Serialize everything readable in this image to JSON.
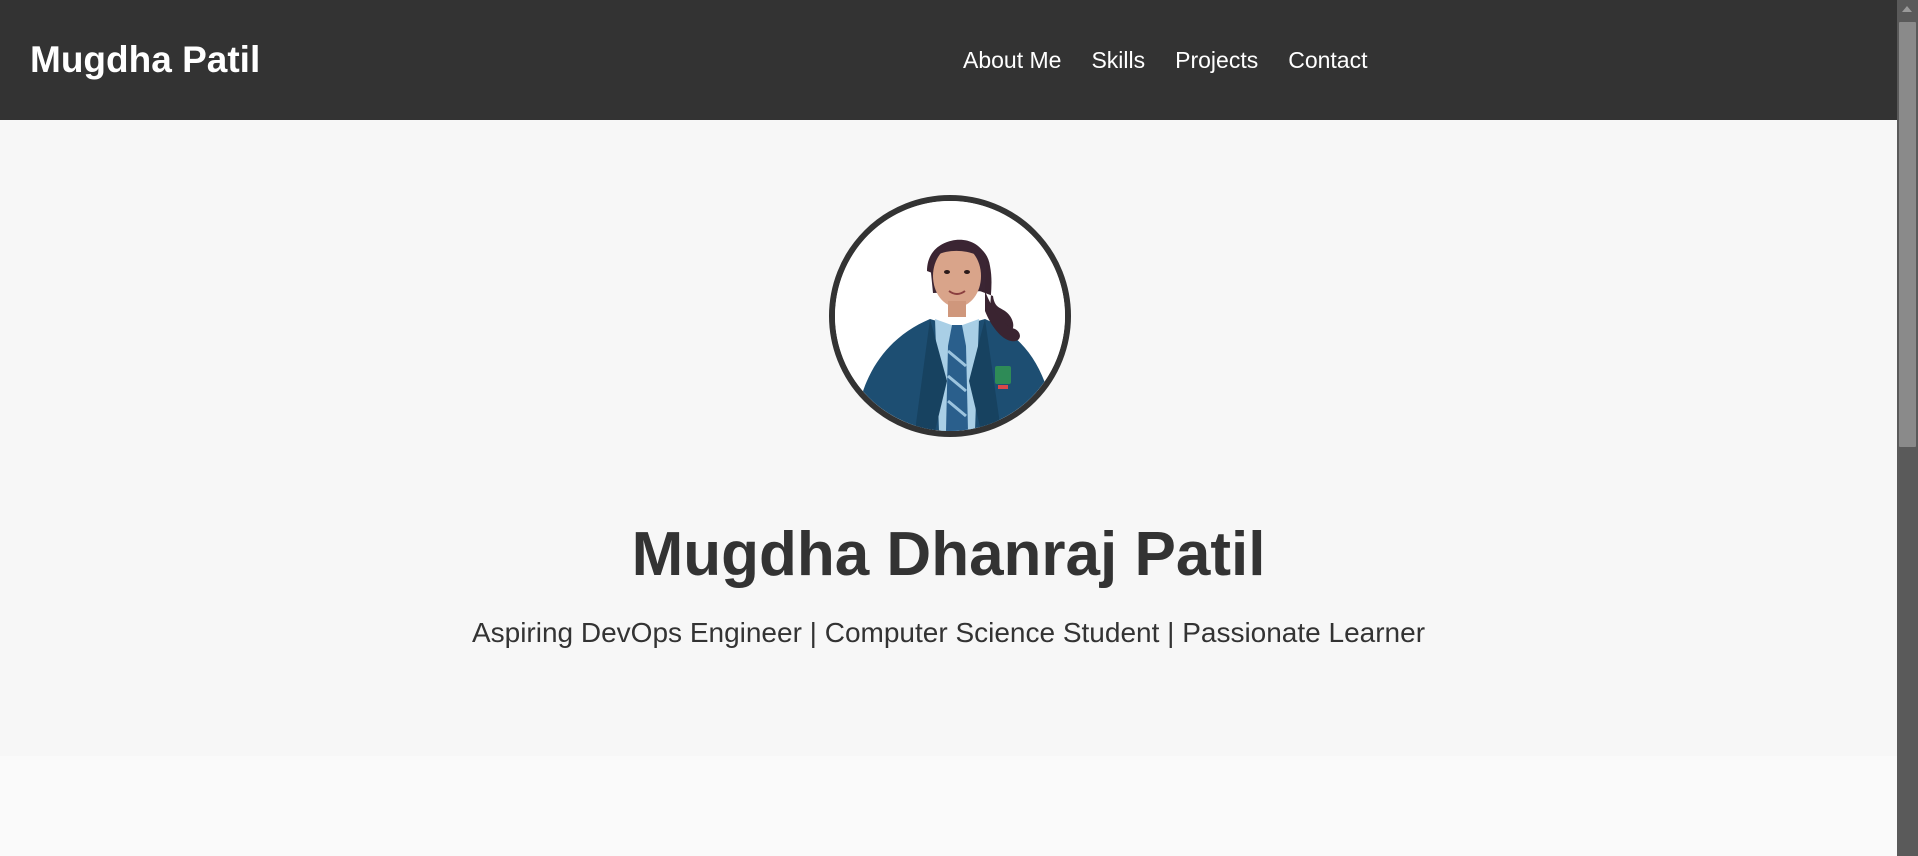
{
  "header": {
    "brand": "Mugdha Patil",
    "nav": [
      {
        "label": "About Me"
      },
      {
        "label": "Skills"
      },
      {
        "label": "Projects"
      },
      {
        "label": "Contact"
      }
    ]
  },
  "hero": {
    "avatar_icon": "profile-photo",
    "name": "Mugdha Dhanraj Patil",
    "tagline": "Aspiring DevOps Engineer | Computer Science Student | Passionate Learner"
  },
  "colors": {
    "navbar": "#333333",
    "hero_background": "#f7f7f7",
    "text": "#333333",
    "nav_text": "#ffffff"
  }
}
